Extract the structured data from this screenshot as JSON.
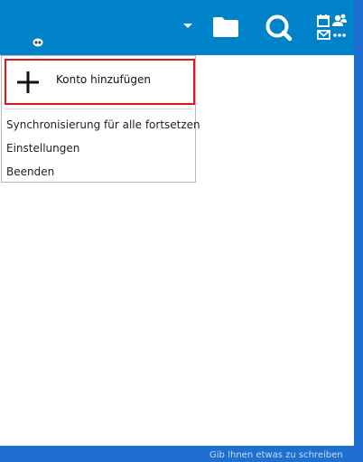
{
  "header": {
    "account_avatar_icon": "user-avatar-icon",
    "dropdown_icon": "caret-down-icon",
    "files_icon": "folder-icon",
    "search_icon": "search-icon",
    "apps_icon": "calendar-contacts-mail-icon",
    "background_color": "#0082c9"
  },
  "menu": {
    "add_account": {
      "icon": "plus-icon",
      "label": "Konto hinzufügen",
      "highlight_color": "#e0161b"
    },
    "items": [
      {
        "label": "Synchronisierung für alle fortsetzen"
      },
      {
        "label": "Einstellungen"
      },
      {
        "label": "Beenden"
      }
    ]
  },
  "background": {
    "partial_text": "Gib Ihnen etwas zu schreiben"
  }
}
